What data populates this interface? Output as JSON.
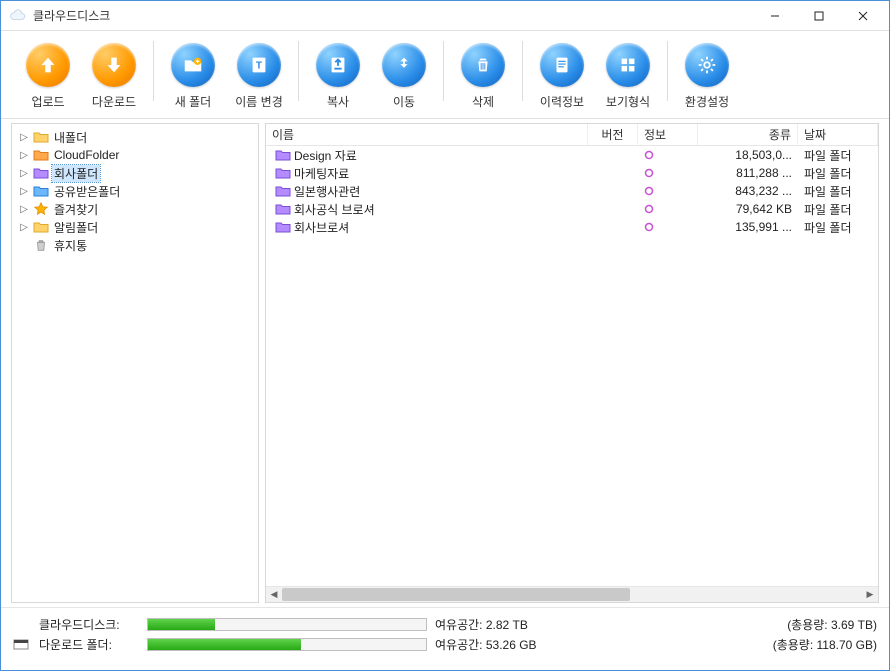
{
  "window": {
    "title": "클라우드디스크"
  },
  "toolbar": {
    "upload": "업로드",
    "download": "다운로드",
    "newfolder": "새 폴더",
    "rename": "이름 변경",
    "copy": "복사",
    "move": "이동",
    "delete": "삭제",
    "history": "이력정보",
    "viewstyle": "보기형식",
    "settings": "환경설정"
  },
  "tree": {
    "items": [
      {
        "label": "내폴더",
        "icon": "folder-yellow",
        "expandable": true
      },
      {
        "label": "CloudFolder",
        "icon": "folder-orange",
        "expandable": true
      },
      {
        "label": "회사폴더",
        "icon": "folder-purple",
        "expandable": true,
        "selected": true
      },
      {
        "label": "공유받은폴더",
        "icon": "folder-blue",
        "expandable": true
      },
      {
        "label": "즐겨찾기",
        "icon": "star",
        "expandable": true
      },
      {
        "label": "알림폴더",
        "icon": "folder-yellow",
        "expandable": true
      },
      {
        "label": "휴지통",
        "icon": "trash",
        "expandable": false
      }
    ]
  },
  "columns": {
    "name": "이름",
    "ver": "버전",
    "info": "정보",
    "size": "종류",
    "date": "날짜"
  },
  "files": [
    {
      "name": "Design 자료",
      "info": "●",
      "size": "18,503,0...",
      "date": "파일 폴더"
    },
    {
      "name": "마케팅자료",
      "info": "●",
      "size": "811,288 ...",
      "date": "파일 폴더"
    },
    {
      "name": "일본행사관련",
      "info": "●",
      "size": "843,232 ...",
      "date": "파일 폴더"
    },
    {
      "name": "회사공식 브로셔",
      "info": "●",
      "size": "79,642 KB",
      "date": "파일 폴더"
    },
    {
      "name": "회사브로셔",
      "info": "●",
      "size": "135,991 ...",
      "date": "파일 폴더"
    }
  ],
  "status": {
    "cloud_label": "클라우드디스크:",
    "cloud_fill_pct": 24,
    "cloud_free_label": "여유공간:",
    "cloud_free_val": "2.82 TB",
    "cloud_total_label": "(총용량: 3.69 TB)",
    "local_label": "다운로드 폴더:",
    "local_fill_pct": 55,
    "local_free_label": "여유공간:",
    "local_free_val": "53.26 GB",
    "local_total_label": "(총용량: 118.70 GB)"
  }
}
